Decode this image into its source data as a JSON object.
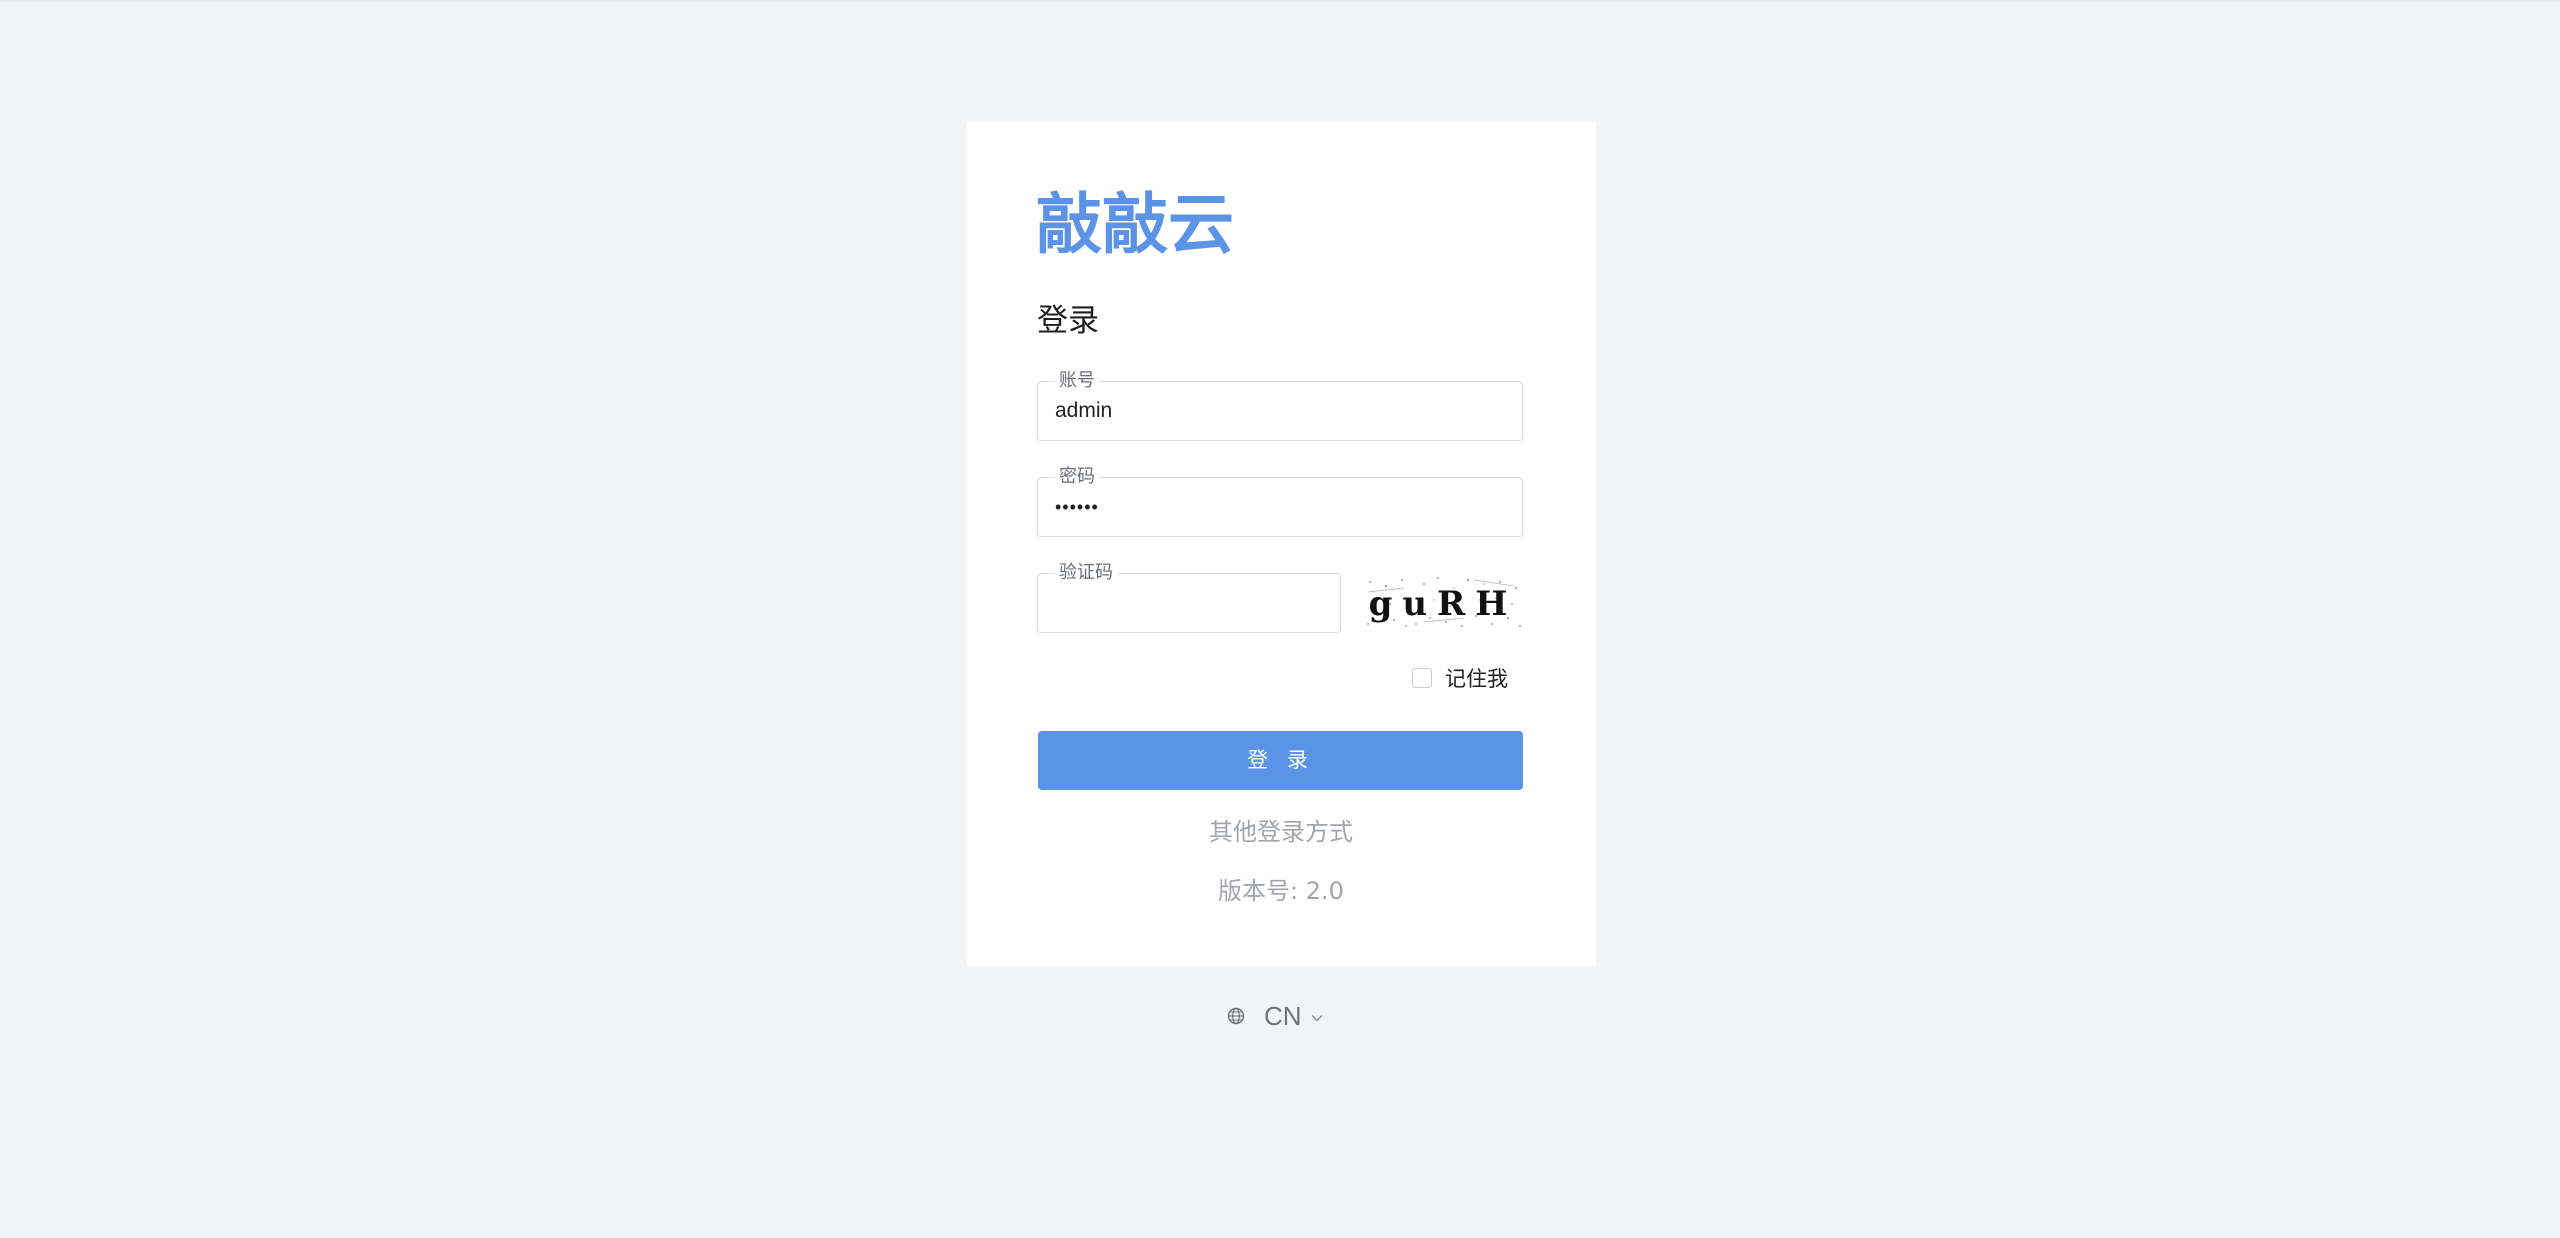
{
  "brand": {
    "logo_text": "敲敲云",
    "accent_color": "#5b93e7"
  },
  "form": {
    "title": "登录",
    "account": {
      "label": "账号",
      "value": "admin"
    },
    "password": {
      "label": "密码",
      "value": "••••••"
    },
    "captcha": {
      "label": "验证码",
      "value": "",
      "image_text": "guRH"
    },
    "remember": {
      "label": "记住我",
      "checked": false
    },
    "submit_label": "登 录"
  },
  "other_login_label": "其他登录方式",
  "version_text": "版本号: 2.0",
  "language": {
    "icon": "globe-icon",
    "label": "CN",
    "dropdown_icon": "chevron-down-icon"
  }
}
